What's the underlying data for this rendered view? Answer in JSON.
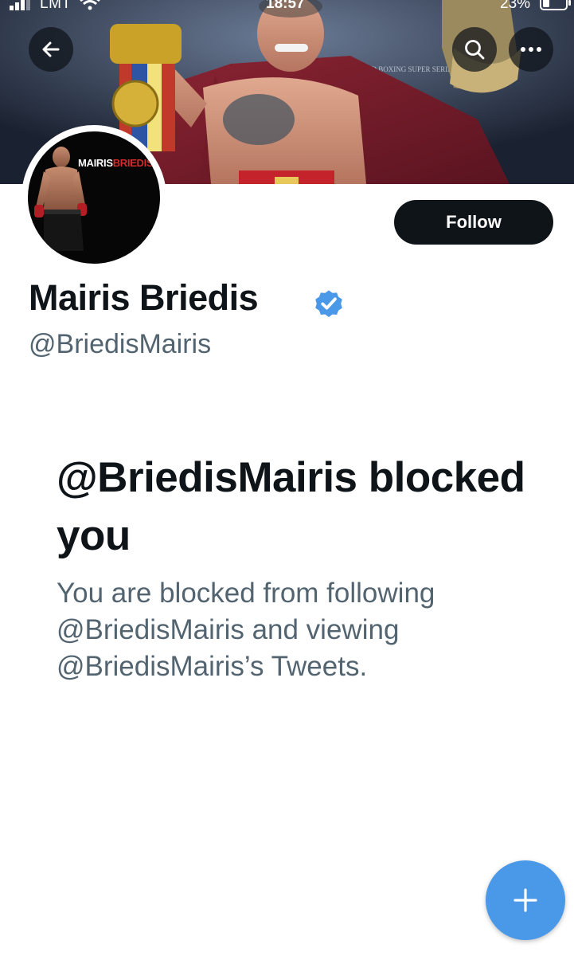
{
  "status_bar": {
    "carrier": "LMT",
    "time": "18:57",
    "battery": "23%"
  },
  "banner": {
    "belt_text": "WORLD BOXING SUPER SERIES"
  },
  "header": {
    "back_icon": "back-arrow-icon",
    "search_icon": "search-icon",
    "more_icon": "more-icon"
  },
  "avatar": {
    "text_first": "MAIRIS",
    "text_last": "BRIEDIS"
  },
  "profile": {
    "display_name": "Mairis Briedis",
    "handle": "@BriedisMairis",
    "follow_label": "Follow",
    "verified_icon": "verified-badge-icon"
  },
  "blocked": {
    "title": "@BriedisMairis blocked you",
    "description": "You are blocked from following @BriedisMairis and viewing @BriedisMairis’s Tweets."
  },
  "fab": {
    "icon": "plus-icon"
  },
  "colors": {
    "accent": "#4a99e9",
    "dark": "#0f1419",
    "secondary_text": "#536471",
    "verified": "#4a99e9"
  }
}
